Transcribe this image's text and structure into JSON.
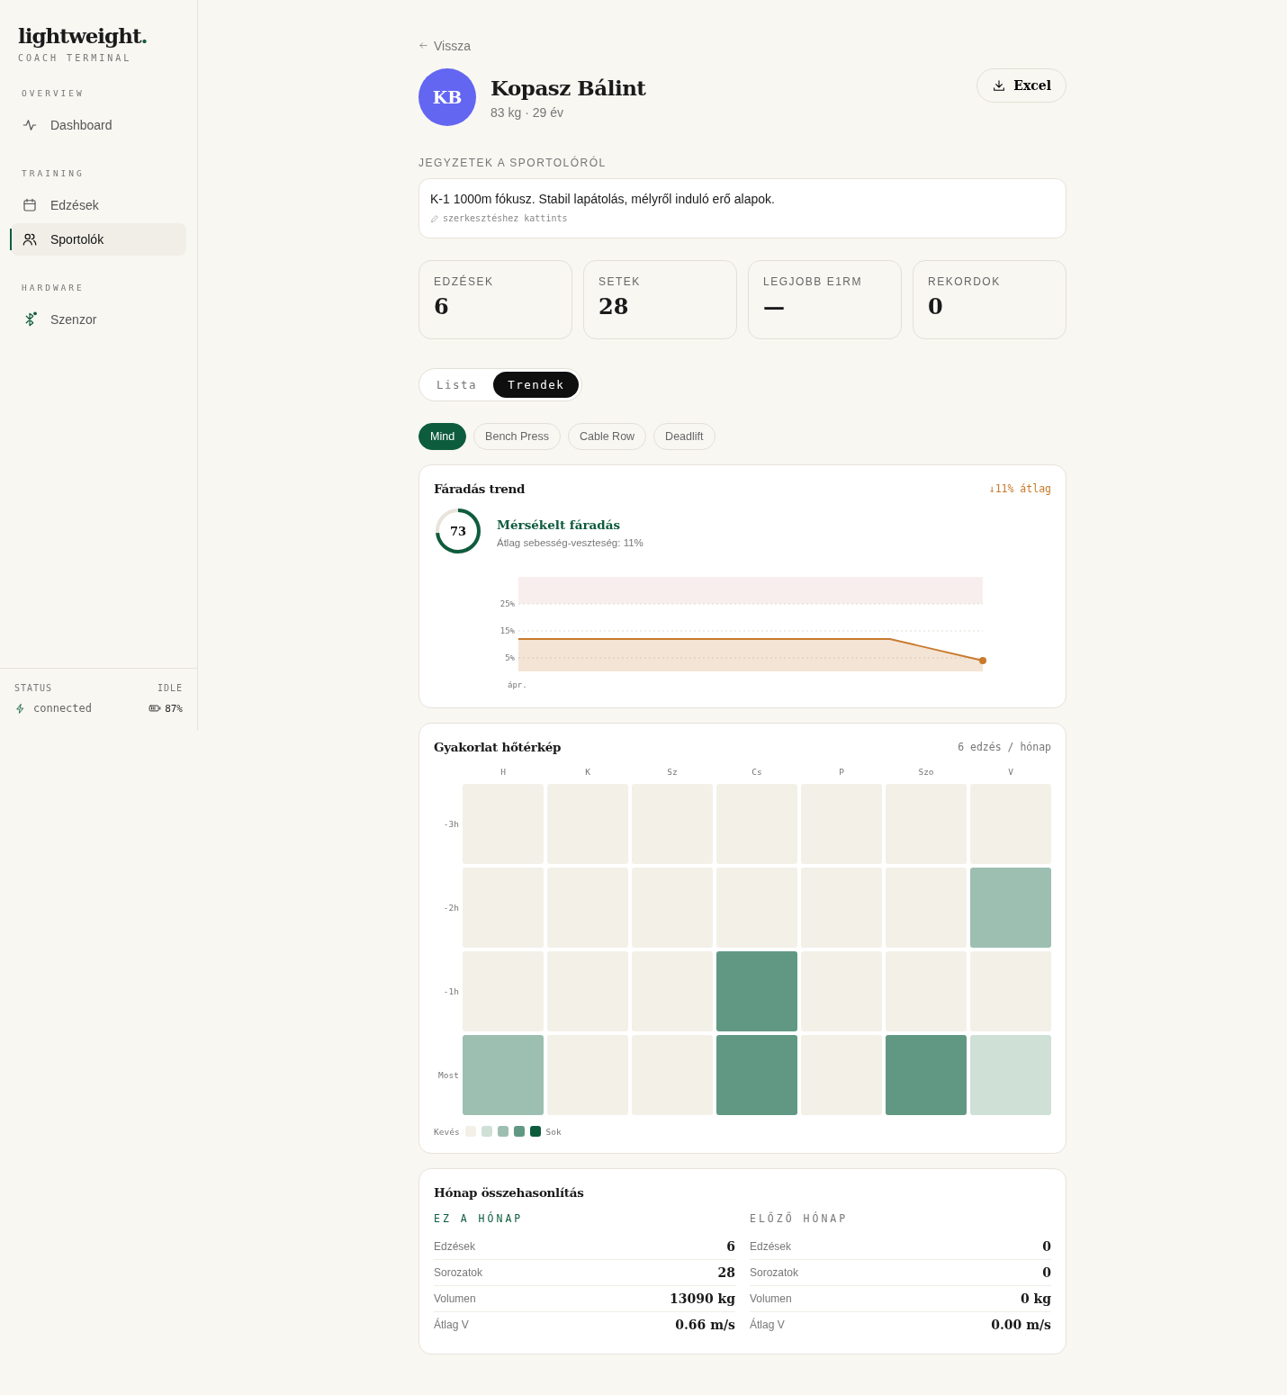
{
  "sidebar": {
    "logo": "lightweight",
    "logo_dot": ".",
    "subtitle": "COACH TERMINAL",
    "sections": [
      {
        "title": "OVERVIEW",
        "items": [
          {
            "label": "Dashboard",
            "selected": false
          }
        ]
      },
      {
        "title": "TRAINING",
        "items": [
          {
            "label": "Edzések",
            "selected": false
          },
          {
            "label": "Sportolók",
            "selected": true
          }
        ]
      },
      {
        "title": "HARDWARE",
        "items": [
          {
            "label": "Szenzor",
            "selected": false
          }
        ]
      }
    ],
    "status": {
      "label": "STATUS",
      "state": "IDLE",
      "connection": "connected",
      "battery": "87%"
    }
  },
  "back_link": "Vissza",
  "athlete": {
    "initials": "KB",
    "name": "Kopasz Bálint",
    "meta": "83 kg · 29 év",
    "export_button": "Excel"
  },
  "notes": {
    "title": "JEGYZETEK A SPORTOLÓRÓL",
    "text": "K-1 1000m fókusz. Stabil lapátolás, mélyről induló erő alapok.",
    "hint": "szerkesztéshez kattints"
  },
  "stats": [
    {
      "label": "EDZÉSEK",
      "value": "6"
    },
    {
      "label": "SETEK",
      "value": "28"
    },
    {
      "label": "LEGJOBB E1RM",
      "value": "—"
    },
    {
      "label": "REKORDOK",
      "value": "0"
    }
  ],
  "view_tabs": [
    {
      "label": "Lista",
      "selected": false
    },
    {
      "label": "Trendek",
      "selected": true
    }
  ],
  "filters": [
    {
      "label": "Mind",
      "selected": true
    },
    {
      "label": "Bench Press",
      "selected": false
    },
    {
      "label": "Cable Row",
      "selected": false
    },
    {
      "label": "Deadlift",
      "selected": false
    }
  ],
  "fatigue": {
    "title": "Fáradás trend",
    "badge": "↓11% átlag",
    "score": "73",
    "status": "Mérsékelt fáradás",
    "detail": "Átlag sebesség-veszteség: 11%",
    "period_label": "ápr.",
    "chart_data": {
      "type": "area",
      "grid": true,
      "ylim": [
        0,
        25
      ],
      "yticks": [
        {
          "value": 5,
          "label": "5%"
        },
        {
          "value": 15,
          "label": "15%"
        },
        {
          "value": 25,
          "label": "25%"
        }
      ],
      "series": [
        {
          "color": "#c97a2c",
          "values": [
            12,
            12,
            12,
            12,
            12,
            4
          ]
        }
      ]
    }
  },
  "heatmap": {
    "title": "Gyakorlat hőtérkép",
    "summary": "6 edzés / hónap",
    "columns": [
      "H",
      "K",
      "Sz",
      "Cs",
      "P",
      "Szo",
      "V"
    ],
    "rows": [
      {
        "label": "-3h",
        "cells": [
          {
            "color": "#f3f0e8"
          },
          {
            "color": "#f3f0e8"
          },
          {
            "color": "#f3f0e8"
          },
          {
            "color": "#f3f0e8"
          },
          {
            "color": "#f3f0e8"
          },
          {
            "color": "#f3f0e8"
          },
          {
            "color": "#f3f0e8"
          }
        ]
      },
      {
        "label": "-2h",
        "cells": [
          {
            "color": "#f3f0e8"
          },
          {
            "color": "#f3f0e8"
          },
          {
            "color": "#f3f0e8"
          },
          {
            "color": "#f3f0e8"
          },
          {
            "color": "#f3f0e8"
          },
          {
            "color": "#f3f0e8"
          },
          {
            "color": "#9dbfb2"
          }
        ]
      },
      {
        "label": "-1h",
        "cells": [
          {
            "color": "#f3f0e8"
          },
          {
            "color": "#f3f0e8"
          },
          {
            "color": "#f3f0e8"
          },
          {
            "color": "#619884"
          },
          {
            "color": "#f3f0e8"
          },
          {
            "color": "#f3f0e8"
          },
          {
            "color": "#f3f0e8"
          }
        ]
      },
      {
        "label": "Most",
        "cells": [
          {
            "color": "#9dbfb2"
          },
          {
            "color": "#f3f0e8"
          },
          {
            "color": "#f3f0e8"
          },
          {
            "color": "#619884"
          },
          {
            "color": "#f3f0e8"
          },
          {
            "color": "#619884"
          },
          {
            "color": "#cfe0d7"
          }
        ]
      }
    ],
    "legend": {
      "low": "Kevés",
      "high": "Sok",
      "swatches": [
        {
          "color": "#f3f0e8"
        },
        {
          "color": "#cfe0d7"
        },
        {
          "color": "#9dbfb2"
        },
        {
          "color": "#619884"
        },
        {
          "color": "#0e5c3e"
        }
      ]
    }
  },
  "comparison": {
    "title": "Hónap összehasonlítás",
    "columns": [
      {
        "title": "EZ A HÓNAP",
        "kind": "current",
        "rows": [
          {
            "label": "Edzések",
            "value": "6"
          },
          {
            "label": "Sorozatok",
            "value": "28"
          },
          {
            "label": "Volumen",
            "value": "13090 kg"
          },
          {
            "label": "Átlag V",
            "value": "0.66 m/s"
          }
        ]
      },
      {
        "title": "ELŐZŐ HÓNAP",
        "kind": "previous",
        "rows": [
          {
            "label": "Edzések",
            "value": "0"
          },
          {
            "label": "Sorozatok",
            "value": "0"
          },
          {
            "label": "Volumen",
            "value": "0 kg"
          },
          {
            "label": "Átlag V",
            "value": "0.00 m/s"
          }
        ]
      }
    ]
  }
}
